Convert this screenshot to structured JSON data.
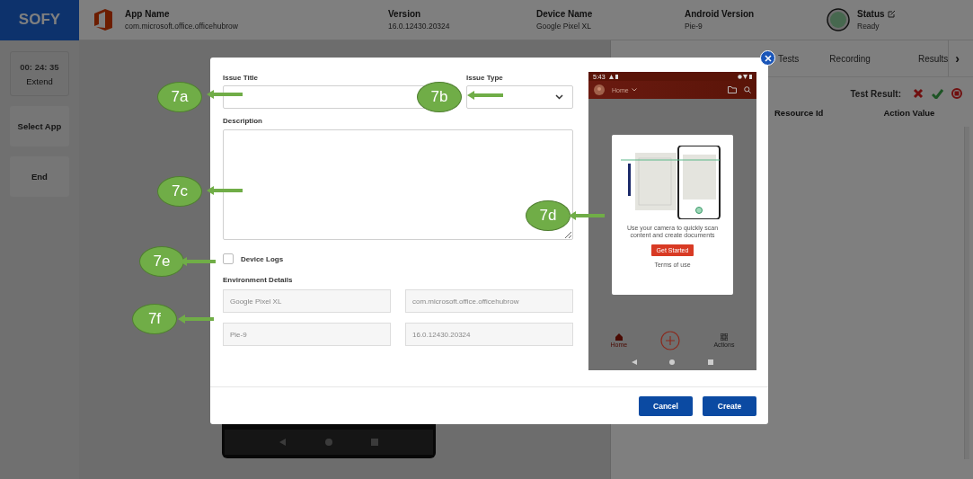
{
  "header": {
    "logo": "SOFY",
    "fields": [
      {
        "label": "App Name",
        "value": "com.microsoft.office.officehubrow"
      },
      {
        "label": "Version",
        "value": "16.0.12430.20324"
      },
      {
        "label": "Device Name",
        "value": "Google Pixel XL"
      },
      {
        "label": "Android Version",
        "value": "Pie-9"
      }
    ],
    "status": {
      "label": "Status",
      "value": "Ready"
    }
  },
  "sidebar": {
    "timer": "00: 24: 35",
    "extend": "Extend",
    "buttons": [
      {
        "label": "Select App",
        "disabled": true
      },
      {
        "label": "End",
        "disabled": true
      }
    ]
  },
  "right_panel": {
    "next": "›",
    "tabs": [
      {
        "label": "Tests",
        "selected": false
      },
      {
        "label": "Recording",
        "selected": false
      },
      {
        "label": "Results",
        "selected": false
      }
    ],
    "test_result_label": "Test Result:",
    "columns": [
      "Resource Id",
      "Action Value"
    ]
  },
  "dialog": {
    "issue_title_label": "Issue Title",
    "issue_type_label": "Issue Type",
    "description_label": "Description",
    "device_logs": {
      "label": "Device Logs",
      "checked": false
    },
    "environment_label": "Environment Details",
    "environment_fields": [
      "Google Pixel XL",
      "com.microsoft.office.officehubrow",
      "Pie-9",
      "16.0.12430.20324"
    ],
    "buttons": [
      {
        "label": "Cancel"
      },
      {
        "label": "Create"
      }
    ],
    "preview": {
      "time": "5:43",
      "title": "Home",
      "message": "Use your camera to quickly scan content and create documents",
      "action": "Get Started",
      "link": "Terms of use",
      "nav": [
        {
          "label": "Home",
          "selected": true
        },
        {
          "label": "Actions",
          "selected": false
        }
      ]
    }
  },
  "callouts": [
    {
      "label": "7a"
    },
    {
      "label": "7b"
    },
    {
      "label": "7c"
    },
    {
      "label": "7d"
    },
    {
      "label": "7e"
    },
    {
      "label": "7f"
    }
  ]
}
